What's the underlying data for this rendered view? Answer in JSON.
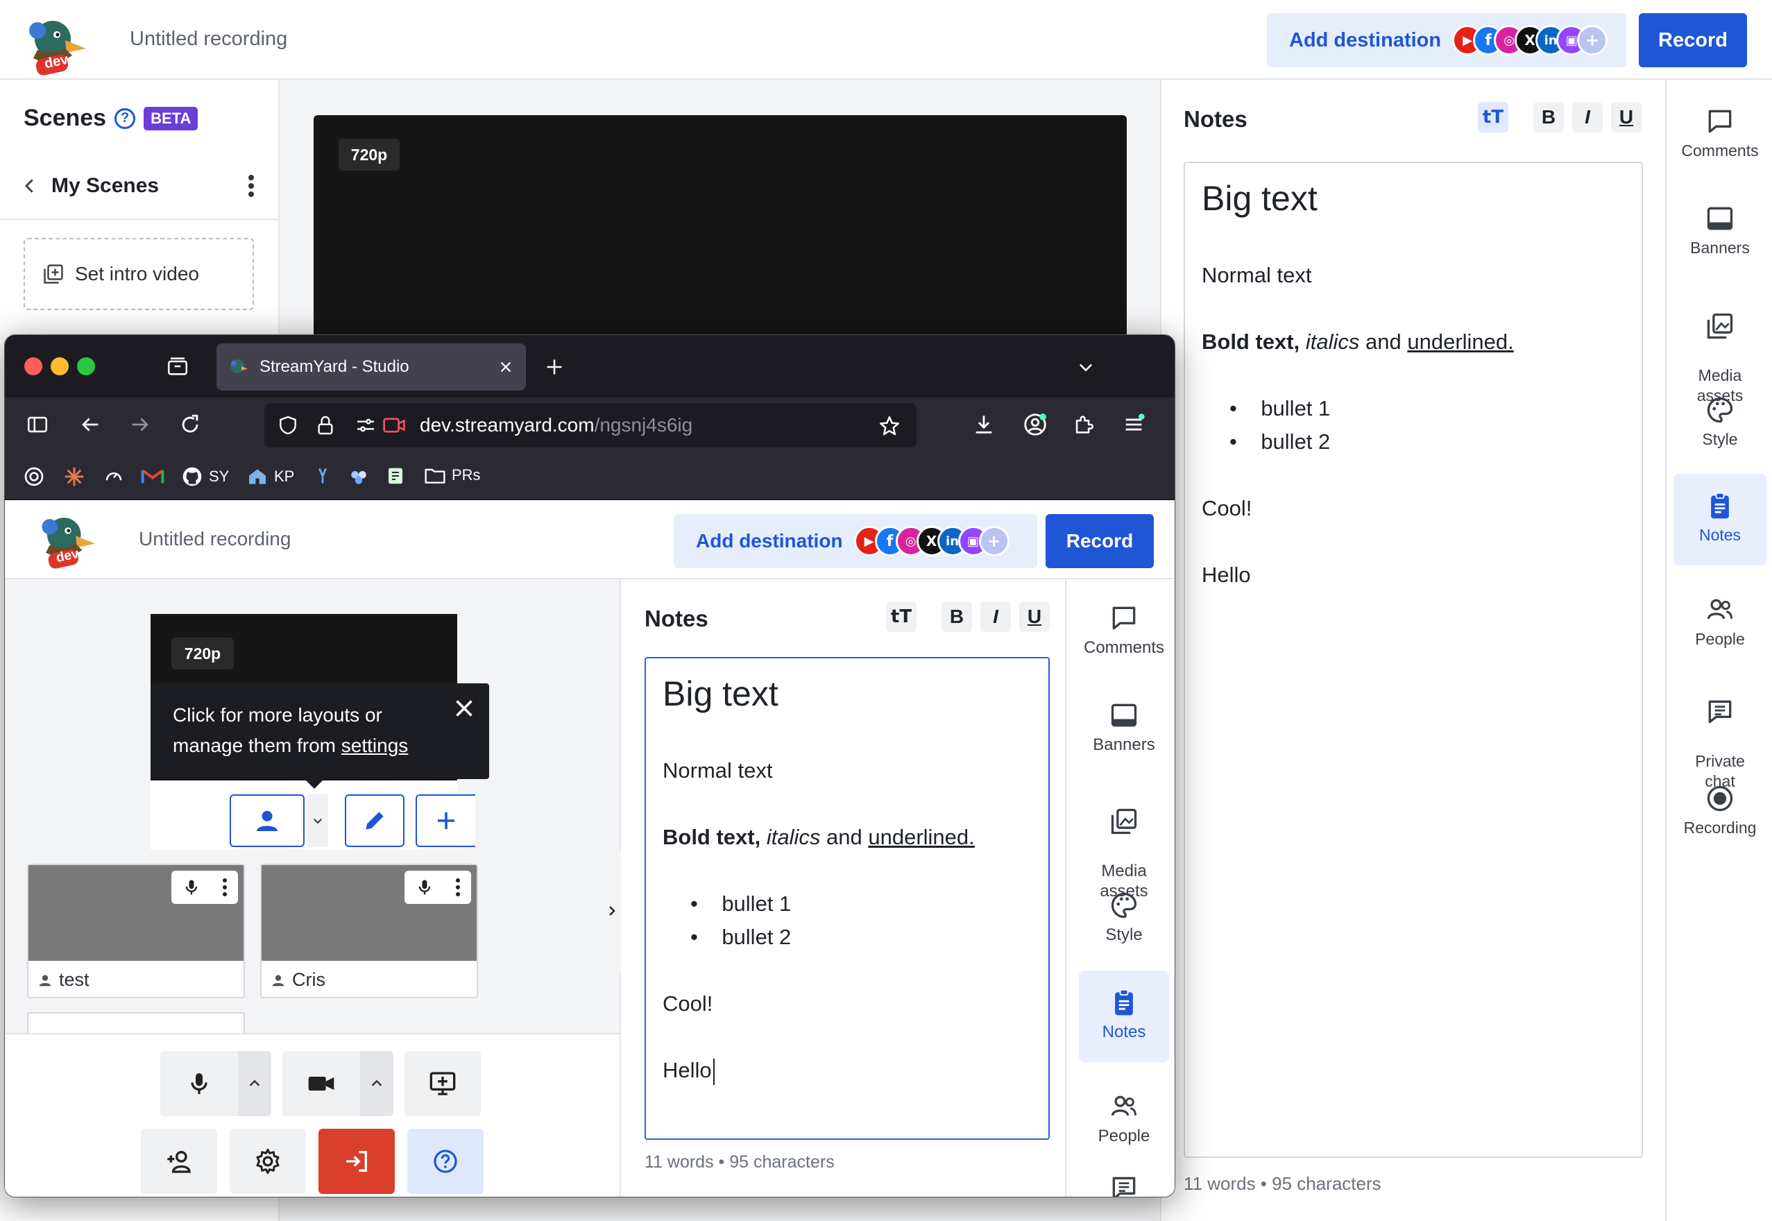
{
  "app": {
    "recording_title": "Untitled recording",
    "logo_badge": "dev",
    "add_destination_label": "Add destination",
    "record_label": "Record",
    "destinations": [
      "youtube-icon",
      "facebook-icon",
      "instagram-icon",
      "x-icon",
      "linkedin-icon",
      "twitch-icon",
      "plus-icon"
    ],
    "accent_color": "#1f56d6"
  },
  "scenes": {
    "title": "Scenes",
    "badge": "BETA",
    "group_name": "My Scenes",
    "intro_label": "Set intro video"
  },
  "stage": {
    "resolution": "720p"
  },
  "notes": {
    "title": "Notes",
    "format_buttons": [
      "tT",
      "B",
      "I",
      "U"
    ],
    "big_text": "Big text",
    "normal_text": "Normal text",
    "bold_part": "Bold text,",
    "italic_part": "italics",
    "and_word": "and",
    "underlined_part": "underlined.",
    "bullets": [
      "bullet 1",
      "bullet 2"
    ],
    "line_cool": "Cool!",
    "line_hello": "Hello",
    "counter": "11 words • 95 characters"
  },
  "rail": {
    "items": [
      {
        "label": "Comments",
        "icon": "comment-icon"
      },
      {
        "label": "Banners",
        "icon": "banner-icon"
      },
      {
        "label": "Media\nassets",
        "icon": "media-icon"
      },
      {
        "label": "Style",
        "icon": "palette-icon"
      },
      {
        "label": "Notes",
        "icon": "notes-icon"
      },
      {
        "label": "People",
        "icon": "people-icon"
      },
      {
        "label": "Private\nchat",
        "icon": "chat-icon"
      },
      {
        "label": "Recording",
        "icon": "record-icon"
      }
    ],
    "active": "Notes"
  },
  "browser": {
    "tab_title": "StreamYard - Studio",
    "url_domain": "dev.streamyard.com",
    "url_path": "/ngsnj4s6ig",
    "bookmarks": [
      "SY",
      "KP",
      "PRs"
    ]
  },
  "studio": {
    "tooltip_line1": "Click for more layouts or",
    "tooltip_line2": "manage them from ",
    "tooltip_link": "settings",
    "participants": [
      "test",
      "Cris"
    ]
  }
}
